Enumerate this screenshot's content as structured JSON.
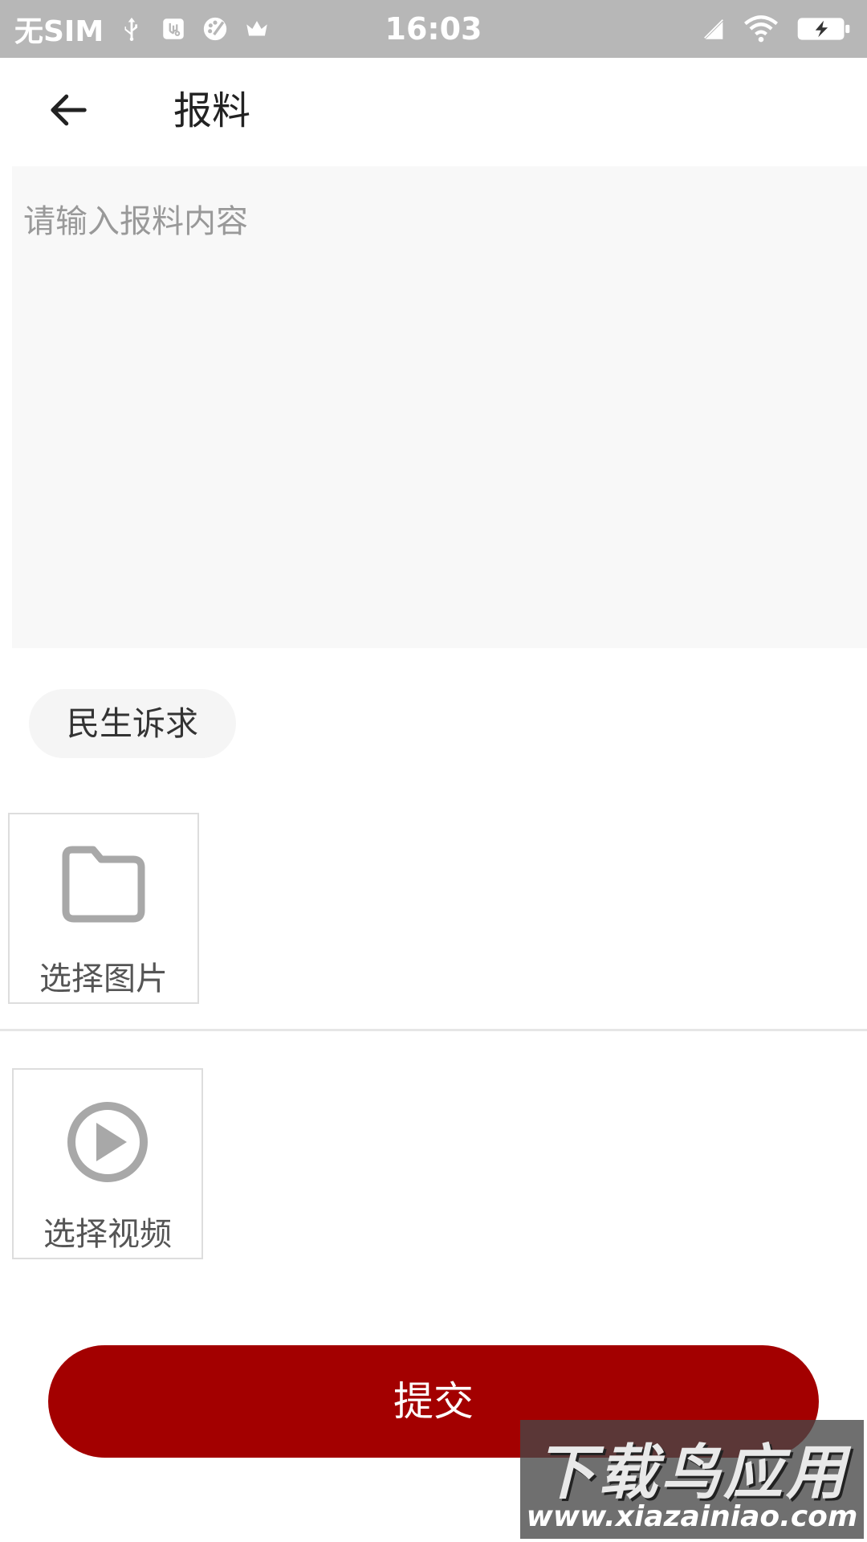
{
  "status_bar": {
    "carrier": "无SIM",
    "time": "16:03",
    "left_icons": [
      "usb-icon",
      "usb-debug-icon",
      "palette-icon",
      "crown-icon"
    ],
    "right_icons": [
      "no-sim-signal-icon",
      "wifi-icon",
      "battery-charging-icon"
    ]
  },
  "header": {
    "title": "报料",
    "back_icon": "arrow-left-icon"
  },
  "form": {
    "content_placeholder": "请输入报料内容",
    "category_label": "民生诉求",
    "image_picker_label": "选择图片",
    "image_picker_icon": "folder-icon",
    "video_picker_label": "选择视频",
    "video_picker_icon": "play-circle-icon",
    "submit_label": "提交"
  },
  "colors": {
    "accent": "#a30000",
    "status_bar_bg": "#b7b7b7",
    "input_bg": "#f8f8f8",
    "icon_gray": "#a8a8a8"
  },
  "watermark": {
    "main": "下载鸟应用",
    "url": "www.xiazainiao.com"
  }
}
